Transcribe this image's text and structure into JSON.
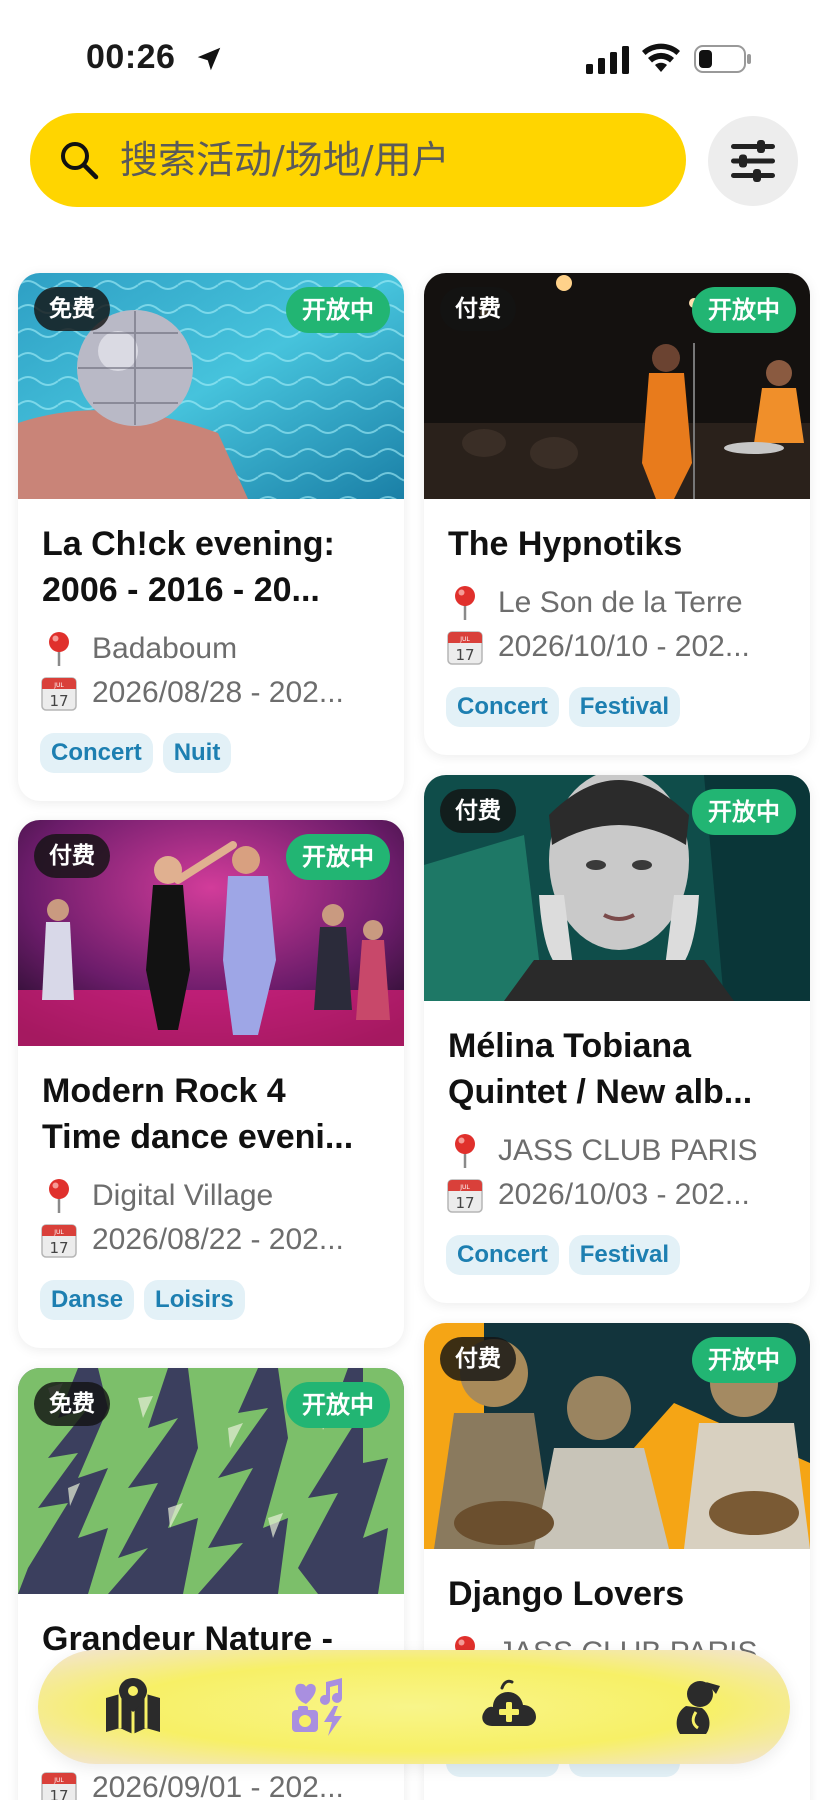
{
  "status_bar": {
    "time": "00:26"
  },
  "search": {
    "placeholder": "搜索活动/场地/用户"
  },
  "colors": {
    "accent": "#ffd500",
    "open_badge": "#22b573",
    "tag_text": "#1d7fb1",
    "tag_bg": "#e3f1f7"
  },
  "events": [
    {
      "price": "免费",
      "status": "开放中",
      "title_line1": "La Ch!ck evening:",
      "title_line2": "2006 - 2016 - 20...",
      "venue": "Badaboum",
      "date": "2026/08/28 - 202...",
      "tags": [
        "Concert",
        "Nuit"
      ]
    },
    {
      "price": "付费",
      "status": "开放中",
      "title_line1": "The Hypnotiks",
      "title_line2": "",
      "venue": "Le Son de la Terre",
      "date": "2026/10/10 - 202...",
      "tags": [
        "Concert",
        "Festival"
      ]
    },
    {
      "price": "付费",
      "status": "开放中",
      "title_line1": "Modern Rock 4",
      "title_line2": "Time dance eveni...",
      "venue": "Digital Village",
      "date": "2026/08/22 - 202...",
      "tags": [
        "Danse",
        "Loisirs"
      ]
    },
    {
      "price": "付费",
      "status": "开放中",
      "title_line1": "Mélina Tobiana",
      "title_line2": "Quintet / New alb...",
      "venue": "JASS CLUB PARIS",
      "date": "2026/10/03 - 202...",
      "tags": [
        "Concert",
        "Festival"
      ]
    },
    {
      "price": "免费",
      "status": "开放中",
      "title_line1": "Grandeur Nature -",
      "title_line2": "",
      "venue": "",
      "date": "2026/09/01 - 202...",
      "tags": []
    },
    {
      "price": "付费",
      "status": "开放中",
      "title_line1": "Django Lovers",
      "title_line2": "",
      "venue": "JASS CLUB PARIS",
      "date": "",
      "tags": [
        "Concert",
        "Festival"
      ]
    }
  ],
  "nav": [
    {
      "icon": "map-icon"
    },
    {
      "icon": "interests-icon"
    },
    {
      "icon": "add-event-cloud-icon"
    },
    {
      "icon": "profile-icon"
    }
  ]
}
